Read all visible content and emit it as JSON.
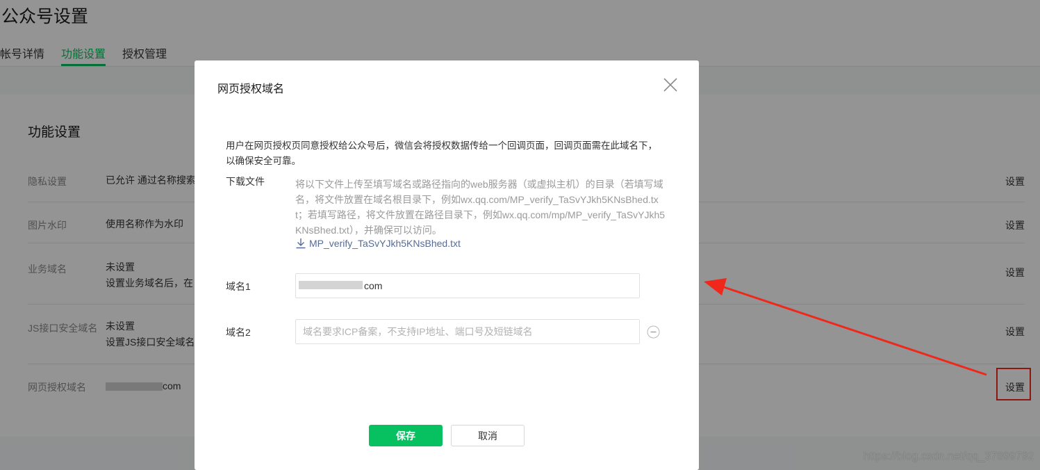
{
  "page": {
    "title": "公众号设置",
    "tabs": [
      {
        "label": "帐号详情"
      },
      {
        "label": "功能设置"
      },
      {
        "label": "授权管理"
      }
    ],
    "section_title": "功能设置",
    "rows": [
      {
        "label": "隐私设置",
        "value": "已允许 通过名称搜索",
        "action": "设置"
      },
      {
        "label": "图片水印",
        "value": "使用名称作为水印",
        "action": "设置"
      },
      {
        "label": "业务域名",
        "value": "未设置",
        "value2": "设置业务域名后，在",
        "action": "设置"
      },
      {
        "label": "JS接口安全域名",
        "value": "未设置",
        "value2": "设置JS接口安全域名",
        "action": "设置"
      },
      {
        "label": "网页授权域名",
        "value_suffix": "com",
        "action": "设置"
      }
    ],
    "watermark": "https://blog.csdn.net/qq_37899792"
  },
  "dialog": {
    "title": "网页授权域名",
    "description": "用户在网页授权页同意授权给公众号后，微信会将授权数据传给一个回调页面，回调页面需在此域名下，以确保安全可靠。",
    "download_label": "下载文件",
    "download_hint": "将以下文件上传至填写域名或路径指向的web服务器（或虚拟主机）的目录（若填写域名，将文件放置在域名根目录下，例如wx.qq.com/MP_verify_TaSvYJkh5KNsBhed.txt；若填写路径，将文件放置在路径目录下，例如wx.qq.com/mp/MP_verify_TaSvYJkh5KNsBhed.txt），并确保可以访问。",
    "download_file": "MP_verify_TaSvYJkh5KNsBhed.txt",
    "domain1_label": "域名1",
    "domain1_value": "com",
    "domain2_label": "域名2",
    "domain2_placeholder": "域名要求ICP备案，不支持IP地址、端口号及短链域名",
    "save_label": "保存",
    "cancel_label": "取消"
  },
  "colors": {
    "accent": "#07c160",
    "link": "#576b95",
    "annotation": "#f0281c"
  }
}
